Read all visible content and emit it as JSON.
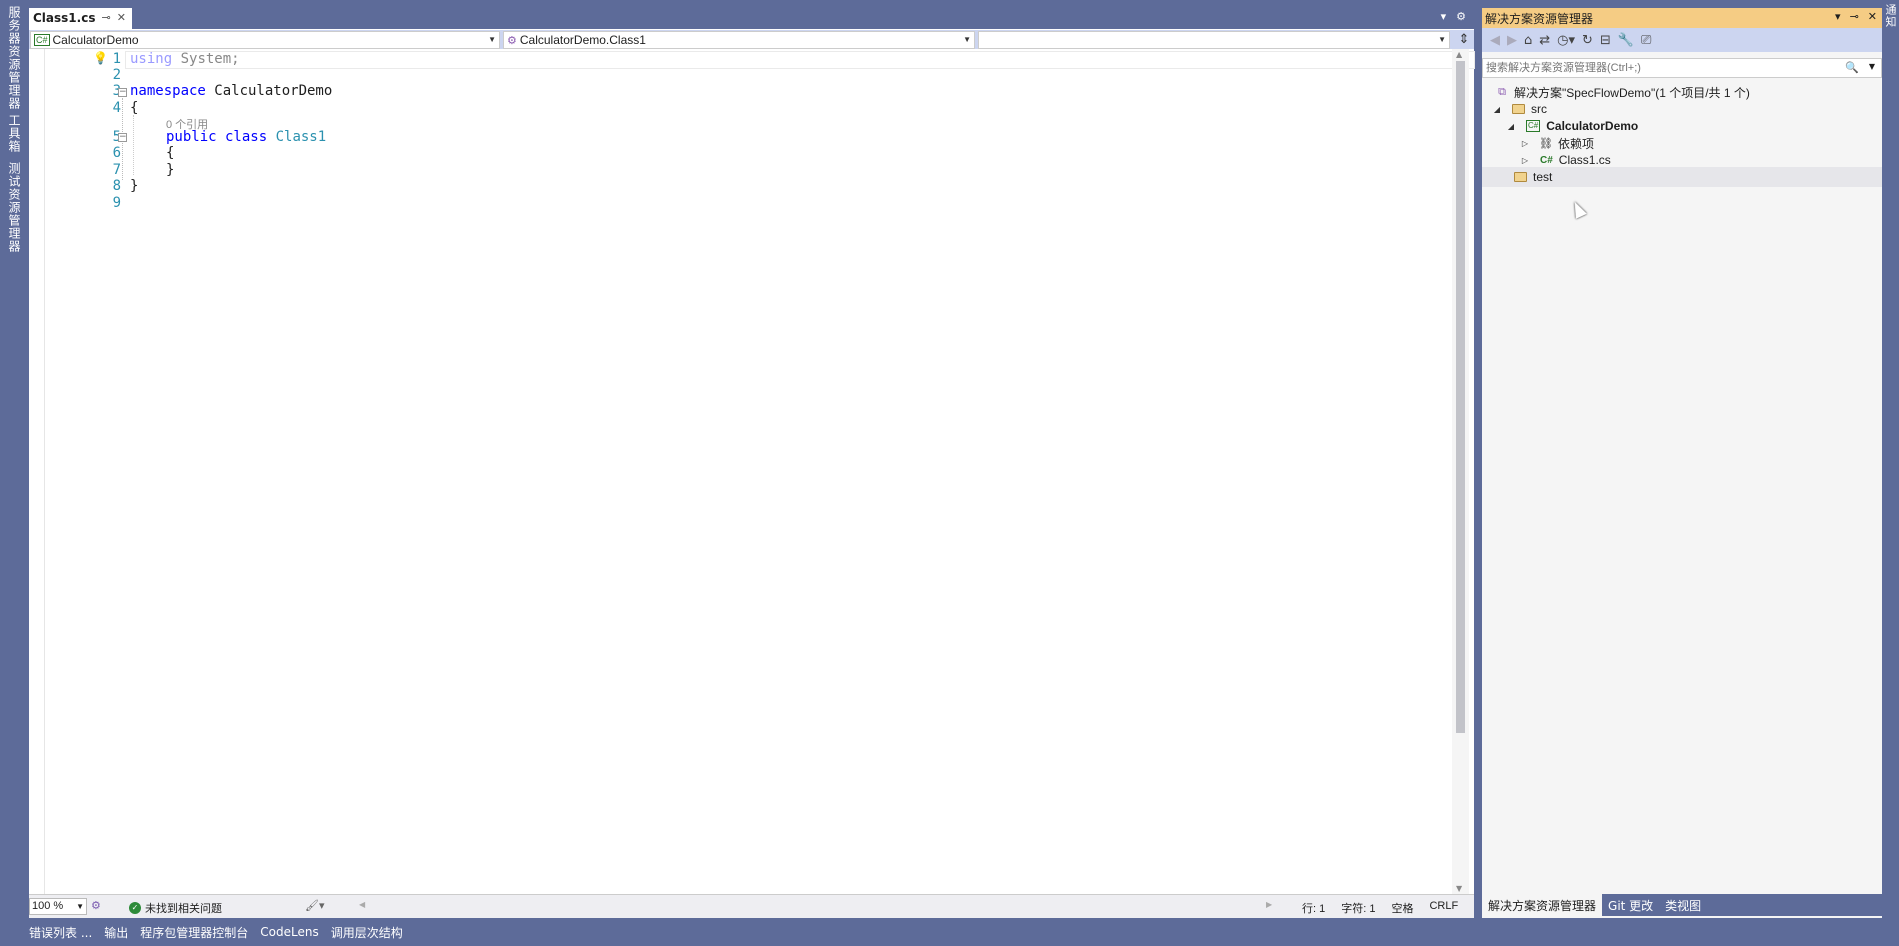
{
  "left_rail": {
    "items": [
      "服务器资源管理器",
      "工具箱",
      "测试资源管理器"
    ]
  },
  "right_rail": {
    "label": "通知"
  },
  "editor": {
    "tab": {
      "title": "Class1.cs",
      "pin": "⊸",
      "close": "✕"
    },
    "nav": {
      "project": "CalculatorDemo",
      "type": "CalculatorDemo.Class1",
      "member": ""
    },
    "lines": [
      {
        "n": "1",
        "text": "using System;"
      },
      {
        "n": "2",
        "text": ""
      },
      {
        "n": "3",
        "text": "namespace CalculatorDemo"
      },
      {
        "n": "4",
        "text": "{"
      },
      {
        "n": "5",
        "text": "public class Class1"
      },
      {
        "n": "6",
        "text": "{"
      },
      {
        "n": "7",
        "text": "}"
      },
      {
        "n": "8",
        "text": "}"
      },
      {
        "n": "9",
        "text": ""
      }
    ],
    "code": {
      "using_kw": "using",
      "using_rest": " System;",
      "ns_kw": "namespace",
      "ns_name": " CalculatorDemo",
      "open1": "{",
      "codelens": "0 个引用",
      "public_kw": "public",
      "class_kw": " class",
      "class_name": " Class1",
      "open2": "{",
      "close2": "}",
      "close1": "}"
    },
    "status": {
      "zoom": "100 %",
      "issues": "未找到相关问题",
      "line": "行: 1",
      "char": "字符: 1",
      "indent": "空格",
      "eol": "CRLF"
    }
  },
  "solution_explorer": {
    "title": "解决方案资源管理器",
    "search_placeholder": "搜索解决方案资源管理器(Ctrl+;)",
    "tree": {
      "solution": "解决方案\"SpecFlowDemo\"(1 个项目/共 1 个)",
      "src": "src",
      "project": "CalculatorDemo",
      "deps": "依赖项",
      "class_file": "Class1.cs",
      "test": "test"
    },
    "tabs": [
      "解决方案资源管理器",
      "Git 更改",
      "类视图"
    ]
  },
  "bottom_bar": {
    "items": [
      "错误列表 ...",
      "输出",
      "程序包管理器控制台",
      "CodeLens",
      "调用层次结构"
    ]
  },
  "colors": {
    "chrome": "#5d6b99",
    "keyword": "#0000ff",
    "type": "#2b91af",
    "solex_title": "#f5cc84"
  }
}
